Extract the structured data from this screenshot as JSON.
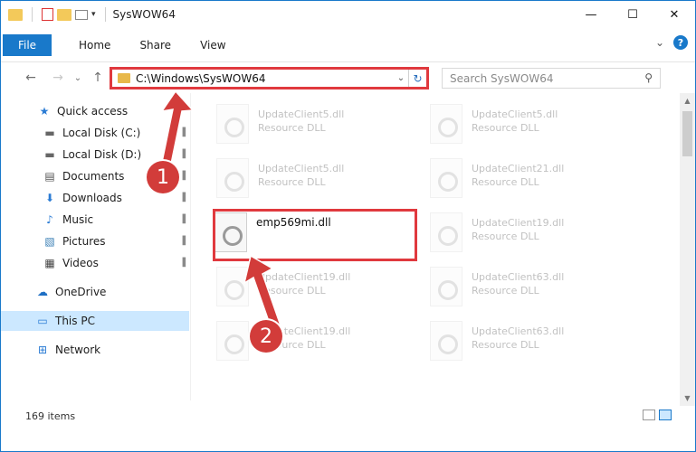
{
  "window": {
    "title": "SysWOW64",
    "minimize": "—",
    "maximize": "☐",
    "close": "✕"
  },
  "ribbon": {
    "tabs": [
      "File",
      "Home",
      "Share",
      "View"
    ],
    "collapse": "⌄",
    "help": "?"
  },
  "nav": {
    "back": "←",
    "forward": "→",
    "recent": "⌄",
    "up": "↑",
    "address": "C:\\Windows\\SysWOW64",
    "address_dropdown": "⌄",
    "refresh": "↻",
    "search_placeholder": "Search SysWOW64",
    "search_icon": "⚲"
  },
  "sidebar": {
    "items": [
      {
        "label": "Quick access",
        "icon": "star-icon",
        "glyph": "★",
        "pinned": false
      },
      {
        "label": "Local Disk (C:)",
        "icon": "drive-icon",
        "glyph": "▬",
        "pinned": true
      },
      {
        "label": "Local Disk (D:)",
        "icon": "drive-icon",
        "glyph": "▬",
        "pinned": true
      },
      {
        "label": "Documents",
        "icon": "documents-icon",
        "glyph": "▤",
        "pinned": true
      },
      {
        "label": "Downloads",
        "icon": "download-icon",
        "glyph": "⬇",
        "pinned": true
      },
      {
        "label": "Music",
        "icon": "music-icon",
        "glyph": "♪",
        "pinned": true
      },
      {
        "label": "Pictures",
        "icon": "pictures-icon",
        "glyph": "▧",
        "pinned": true
      },
      {
        "label": "Videos",
        "icon": "videos-icon",
        "glyph": "▦",
        "pinned": true
      },
      {
        "label": "OneDrive",
        "icon": "cloud-icon",
        "glyph": "☁",
        "pinned": false
      },
      {
        "label": "This PC",
        "icon": "computer-icon",
        "glyph": "▭",
        "pinned": false,
        "selected": true
      },
      {
        "label": "Network",
        "icon": "network-icon",
        "glyph": "⊞",
        "pinned": false
      }
    ],
    "pin_glyph": "📌"
  },
  "files": [
    {
      "name": "UpdateClient5.dll",
      "desc": "Resource DLL",
      "faded": true
    },
    {
      "name": "UpdateClient5.dll",
      "desc": "Resource DLL",
      "faded": true
    },
    {
      "name": "UpdateClient5.dll",
      "desc": "Resource DLL",
      "faded": true
    },
    {
      "name": "UpdateClient21.dll",
      "desc": "Resource DLL",
      "faded": true
    },
    {
      "name": "emp569mi.dll",
      "desc": "",
      "faded": false
    },
    {
      "name": "UpdateClient19.dll",
      "desc": "Resource DLL",
      "faded": true
    },
    {
      "name": "UpdateClient19.dll",
      "desc": "Resource DLL",
      "faded": true
    },
    {
      "name": "UpdateClient63.dll",
      "desc": "Resource DLL",
      "faded": true
    },
    {
      "name": "UpdateClient19.dll",
      "desc": "Resource DLL",
      "faded": true
    },
    {
      "name": "UpdateClient63.dll",
      "desc": "Resource DLL",
      "faded": true
    }
  ],
  "status": {
    "count": "169 items"
  },
  "callouts": [
    "1",
    "2"
  ],
  "colors": {
    "accent": "#1979ca",
    "callout": "#d23c3a",
    "highlight": "#e0393e",
    "selected": "#cce8ff"
  }
}
